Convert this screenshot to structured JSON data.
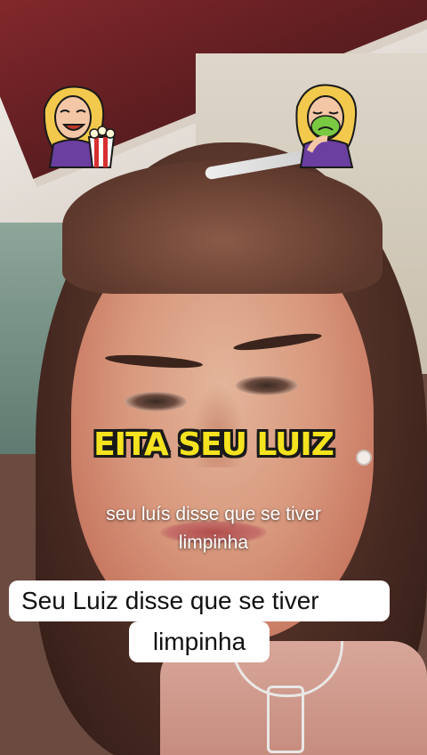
{
  "captions": {
    "title": "EITA SEU LUIZ",
    "subtitle_line1": "seu luís disse que se tiver",
    "subtitle_line2": "limpinha",
    "boxed_line1": "Seu Luiz disse que se tiver",
    "boxed_line2": "limpinha"
  },
  "stickers": {
    "left": "popcorn-woman-sticker-icon",
    "right": "sick-woman-sticker-icon"
  },
  "colors": {
    "title_text": "#f4e31e",
    "title_outline": "#1a1a1a",
    "caption_box": "#ffffff"
  }
}
